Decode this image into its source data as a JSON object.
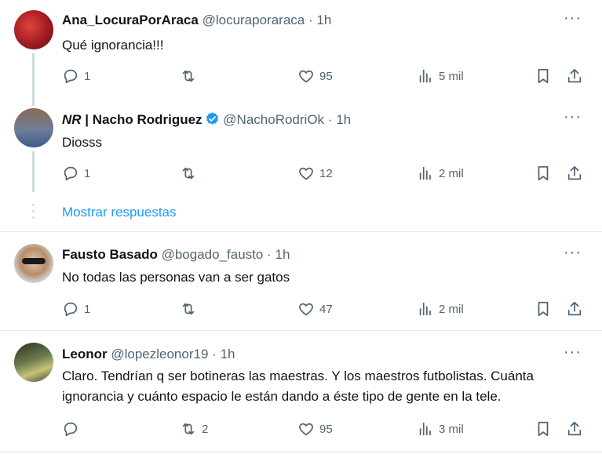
{
  "replies": [
    {
      "name": "Ana_LocuraPorAraca",
      "handle": "@locuraporaraca",
      "separator": "·",
      "time": "1h",
      "text": "Qué ignorancia!!!",
      "reply_count": "1",
      "retweet_count": "",
      "like_count": "95",
      "view_count": "5 mil",
      "avatar_color": "#b32428"
    },
    {
      "name_prefix": "NR",
      "name": "| Nacho Rodriguez",
      "verified": true,
      "handle": "@NachoRodriOk",
      "separator": "·",
      "time": "1h",
      "text": "Diosss",
      "reply_count": "1",
      "retweet_count": "",
      "like_count": "12",
      "view_count": "2 mil",
      "avatar_color": "#3a5a8c"
    },
    {
      "name": "Fausto Basado",
      "handle": "@bogado_fausto",
      "separator": "·",
      "time": "1h",
      "text": "No todas las personas van a ser gatos",
      "reply_count": "1",
      "retweet_count": "",
      "like_count": "47",
      "view_count": "2 mil",
      "avatar_color": "#cfd3d6"
    },
    {
      "name": "Leonor",
      "handle": "@lopezleonor19",
      "separator": "·",
      "time": "1h",
      "text_line1": "Claro. Tendrían q ser botineras las maestras. Y los maestros futbolistas. Cuánta",
      "text_line2": "ignorancia y cuánto espacio le están dando a éste tipo de gente en la tele.",
      "reply_count": "",
      "retweet_count": "2",
      "like_count": "95",
      "view_count": "3 mil",
      "avatar_color": "#6b7b4e"
    }
  ],
  "show_replies_label": "Mostrar respuestas",
  "more_label": "···",
  "colors": {
    "accent": "#1d9bf0",
    "muted": "#536471",
    "divider": "#e7e9ea",
    "verified": "#1d9bf0"
  },
  "icons": [
    "reply-icon",
    "retweet-icon",
    "like-icon",
    "views-icon",
    "bookmark-icon",
    "share-icon",
    "more-icon",
    "verified-icon"
  ]
}
